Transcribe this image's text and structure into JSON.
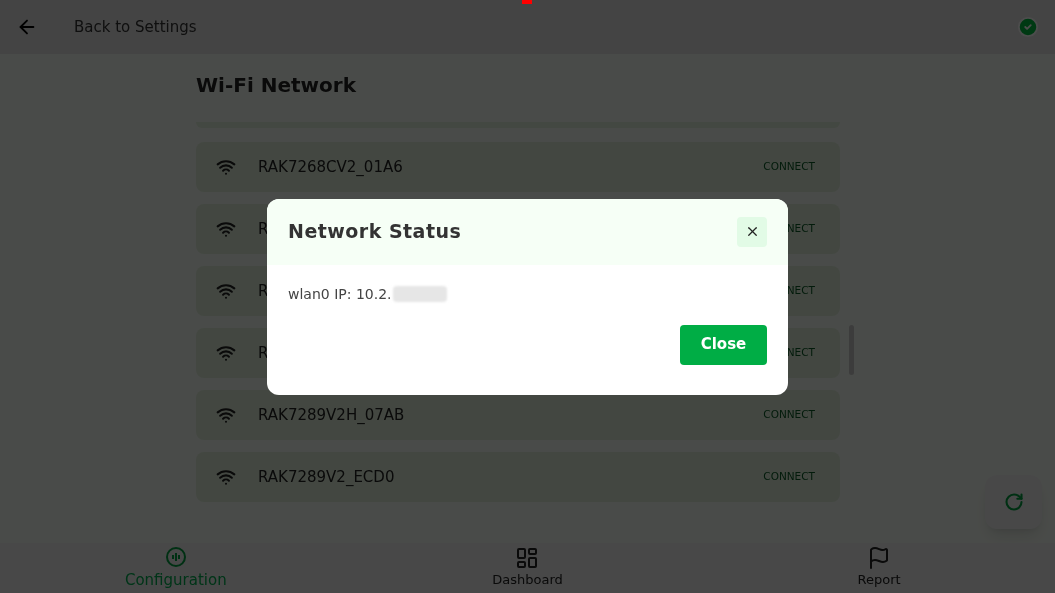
{
  "top_bar": {
    "back_label": "Back to Settings",
    "connected": true
  },
  "page": {
    "title": "Wi-Fi Network"
  },
  "networks": [
    {
      "name": "RAK7268CV2_01A6",
      "action": "CONNECT"
    },
    {
      "name": "R",
      "action": "NECT"
    },
    {
      "name": "R",
      "action": "NECT"
    },
    {
      "name": "R",
      "action": "NECT"
    },
    {
      "name": "RAK7289V2H_07AB",
      "action": "CONNECT"
    },
    {
      "name": "RAK7289V2_ECD0",
      "action": "CONNECT"
    }
  ],
  "bottom_nav": [
    {
      "label": "Configuration",
      "selected": true,
      "kind": "config"
    },
    {
      "label": "Dashboard",
      "selected": false,
      "kind": "dashboard"
    },
    {
      "label": "Report",
      "selected": false,
      "kind": "report"
    }
  ],
  "dialog": {
    "title": "Network Status",
    "message": "wlan0 IP: 10.2.",
    "message_redacted": true,
    "button": "Close"
  }
}
